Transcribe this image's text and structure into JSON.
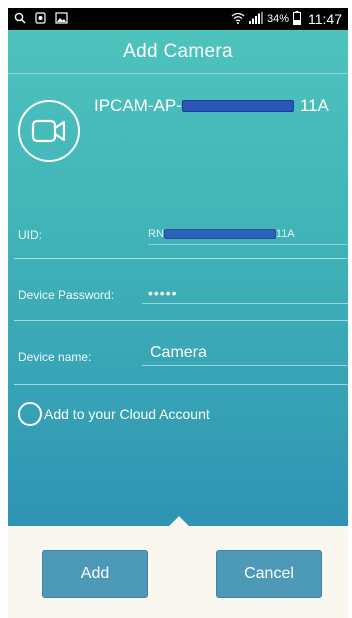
{
  "status_bar": {
    "battery_percent": "34%",
    "time": "11:47",
    "icons": [
      "search-icon",
      "shield-icon",
      "image-icon",
      "wifi-icon",
      "signal-icon",
      "battery-icon"
    ]
  },
  "header": {
    "title": "Add Camera"
  },
  "camera": {
    "icon": "video-camera-icon",
    "name_prefix": "IPCAM-AP-",
    "name_suffix": "11A"
  },
  "fields": {
    "uid": {
      "label": "UID:",
      "value_prefix": "RN",
      "value_suffix": "11A"
    },
    "password": {
      "label": "Device Password:",
      "value": "•••••"
    },
    "device_name": {
      "label": "Device name:",
      "value": "Camera"
    }
  },
  "cloud": {
    "label": "Add to your Cloud Account",
    "checked": false
  },
  "buttons": {
    "add_label": "Add",
    "cancel_label": "Cancel"
  },
  "colors": {
    "gradient_top": "#4ec3bd",
    "gradient_bottom": "#2f94b4",
    "button": "#4c9ab8",
    "footer": "#f9f7f0",
    "redaction": "#2b55b8"
  }
}
